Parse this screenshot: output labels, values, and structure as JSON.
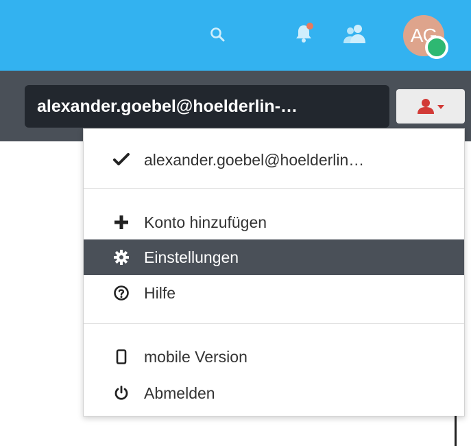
{
  "header": {
    "avatar_initials": "AG",
    "icons": [
      "search-icon",
      "bell-icon",
      "people-icon"
    ],
    "colors": {
      "topbar": "#33b2f0",
      "avatar": "#dea48c",
      "presence": "#2eb872",
      "notification_dot": "#e87a5d"
    }
  },
  "account": {
    "current_email": "alexander.goebel@hoelderlin-…",
    "user_button_icon": "user-icon",
    "colors": {
      "band": "#4a5058",
      "pill": "#22272e",
      "user_icon": "#d23a36"
    }
  },
  "menu": {
    "account_item": {
      "icon": "check-icon",
      "label": "alexander.goebel@hoelderlin…"
    },
    "items": [
      {
        "icon": "plus-icon",
        "label": "Konto hinzufügen"
      },
      {
        "icon": "gear-icon",
        "label": "Einstellungen",
        "active": true
      },
      {
        "icon": "help-icon",
        "label": "Hilfe"
      },
      {
        "icon": "mobile-icon",
        "label": "mobile Version"
      },
      {
        "icon": "power-icon",
        "label": "Abmelden"
      }
    ],
    "colors": {
      "active_bg": "#4a5058",
      "active_text": "#ffffff",
      "text": "#333333"
    }
  }
}
